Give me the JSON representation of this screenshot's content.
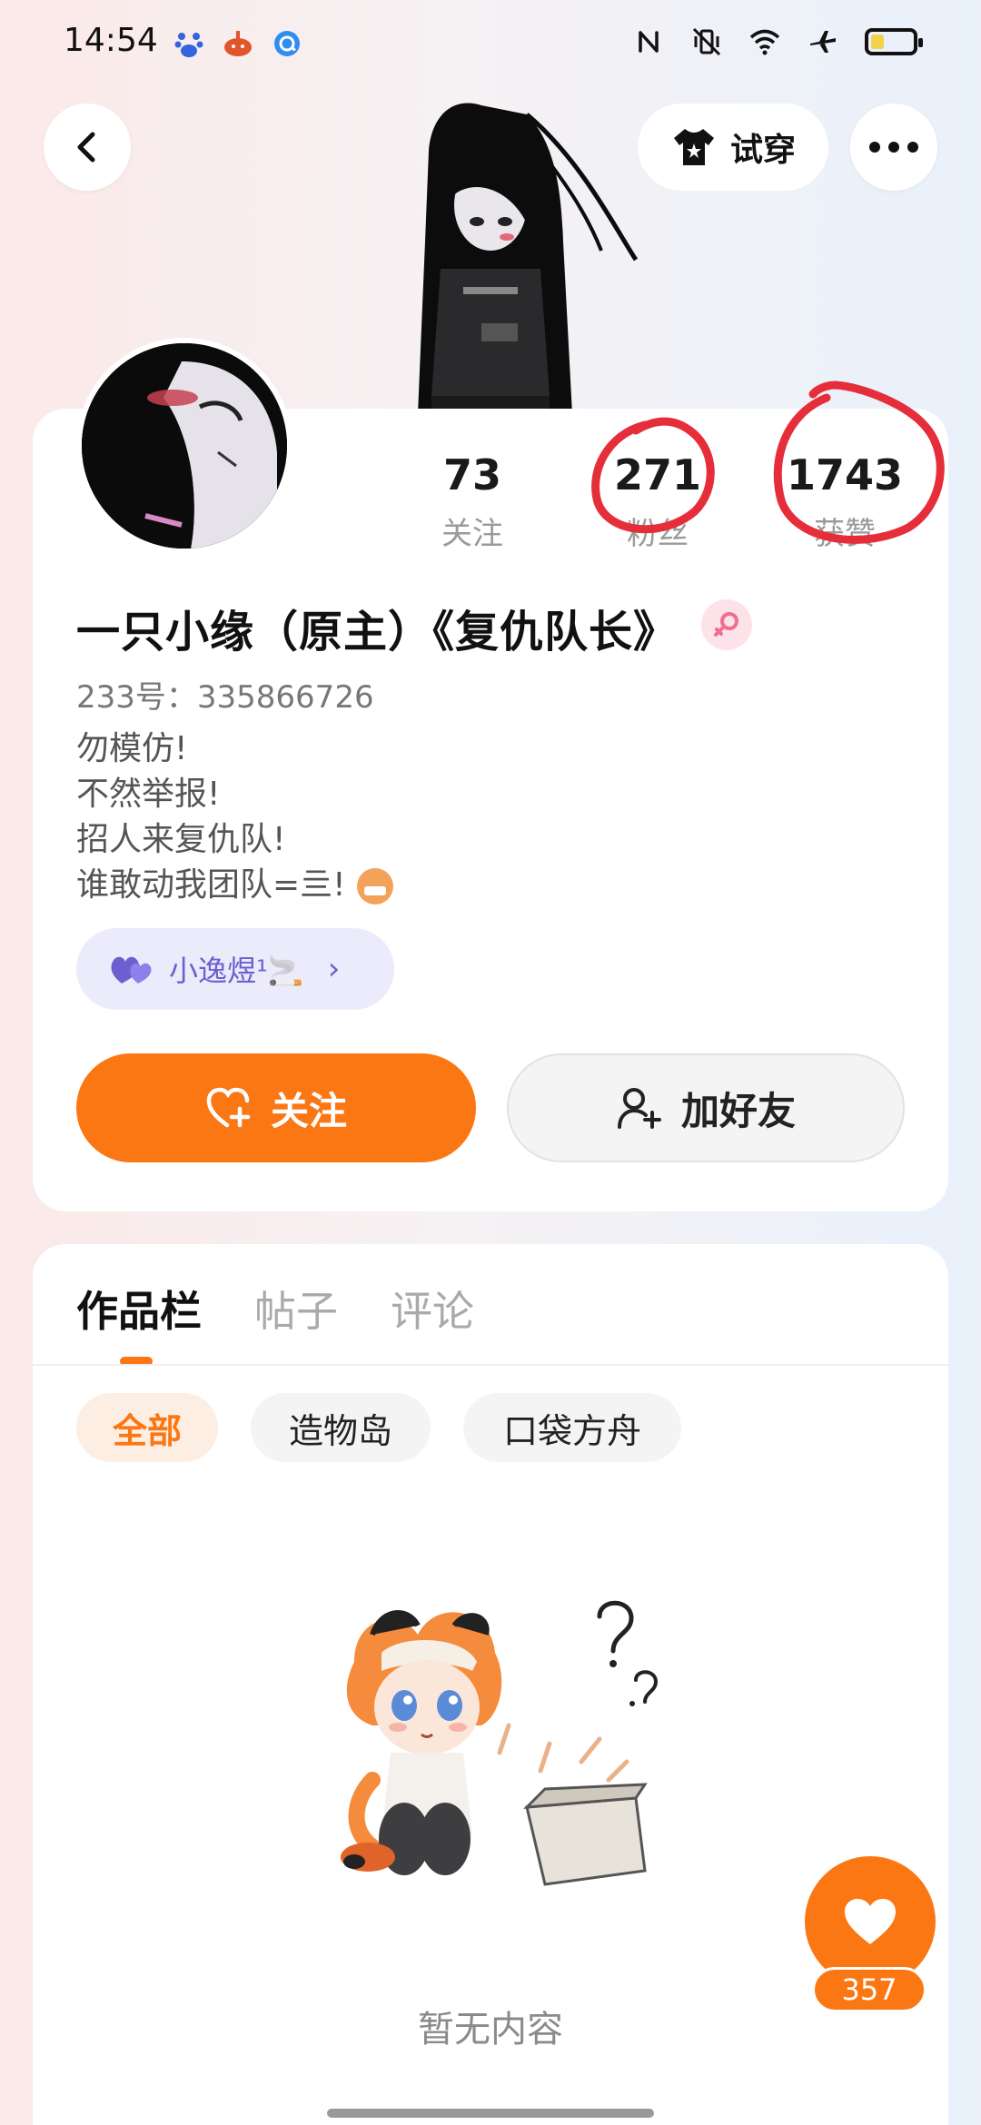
{
  "status_bar": {
    "time": "14:54"
  },
  "header": {
    "tryon_label": "试穿"
  },
  "profile": {
    "stats": [
      {
        "value": "73",
        "label": "关注"
      },
      {
        "value": "271",
        "label": "粉丝"
      },
      {
        "value": "1743",
        "label": "获赞"
      }
    ],
    "username": "一只小缘（原主）《复仇队长》",
    "uid": "233号：335866726",
    "bio": [
      "勿模仿!",
      "不然举报!",
      "招人来复仇队!",
      "谁敢动我团队=亖!"
    ],
    "relation": {
      "label": "小逸煜¹🚬"
    },
    "follow_label": "关注",
    "add_friend_label": "加好友"
  },
  "works": {
    "tabs": [
      "作品栏",
      "帖子",
      "评论"
    ],
    "chips": [
      "全部",
      "造物岛",
      "口袋方舟"
    ],
    "empty_text": "暂无内容"
  },
  "fab": {
    "like_count": "357"
  },
  "colors": {
    "accent": "#fb7714",
    "relation": "#6d5fd0",
    "annotation_red": "#e52e3a"
  }
}
